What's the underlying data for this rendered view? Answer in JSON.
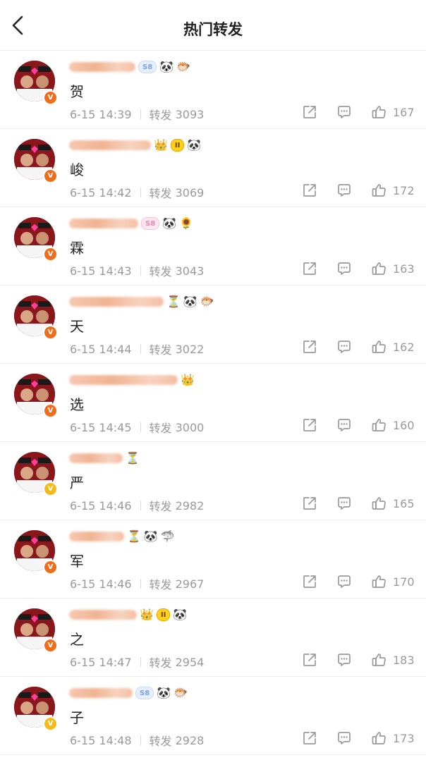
{
  "header": {
    "title": "热门转发",
    "back_icon": "back-arrow-icon"
  },
  "repost_label": "转发",
  "badges": {
    "s8": "S8",
    "ii": "II"
  },
  "items": [
    {
      "content": "贺",
      "time": "6-15 14:39",
      "repost_count": "3093",
      "likes": "167",
      "verified_color": "orange"
    },
    {
      "content": "峻",
      "time": "6-15 14:42",
      "repost_count": "3069",
      "likes": "172",
      "verified_color": "orange"
    },
    {
      "content": "霖",
      "time": "6-15 14:43",
      "repost_count": "3043",
      "likes": "163",
      "verified_color": "orange"
    },
    {
      "content": "天",
      "time": "6-15 14:44",
      "repost_count": "3022",
      "likes": "162",
      "verified_color": "orange"
    },
    {
      "content": "选",
      "time": "6-15 14:45",
      "repost_count": "3000",
      "likes": "160",
      "verified_color": "orange"
    },
    {
      "content": "严",
      "time": "6-15 14:46",
      "repost_count": "2982",
      "likes": "165",
      "verified_color": "yellow"
    },
    {
      "content": "军",
      "time": "6-15 14:46",
      "repost_count": "2967",
      "likes": "170",
      "verified_color": "orange"
    },
    {
      "content": "之",
      "time": "6-15 14:47",
      "repost_count": "2954",
      "likes": "183",
      "verified_color": "orange"
    },
    {
      "content": "子",
      "time": "6-15 14:48",
      "repost_count": "2928",
      "likes": "173",
      "verified_color": "yellow"
    }
  ]
}
